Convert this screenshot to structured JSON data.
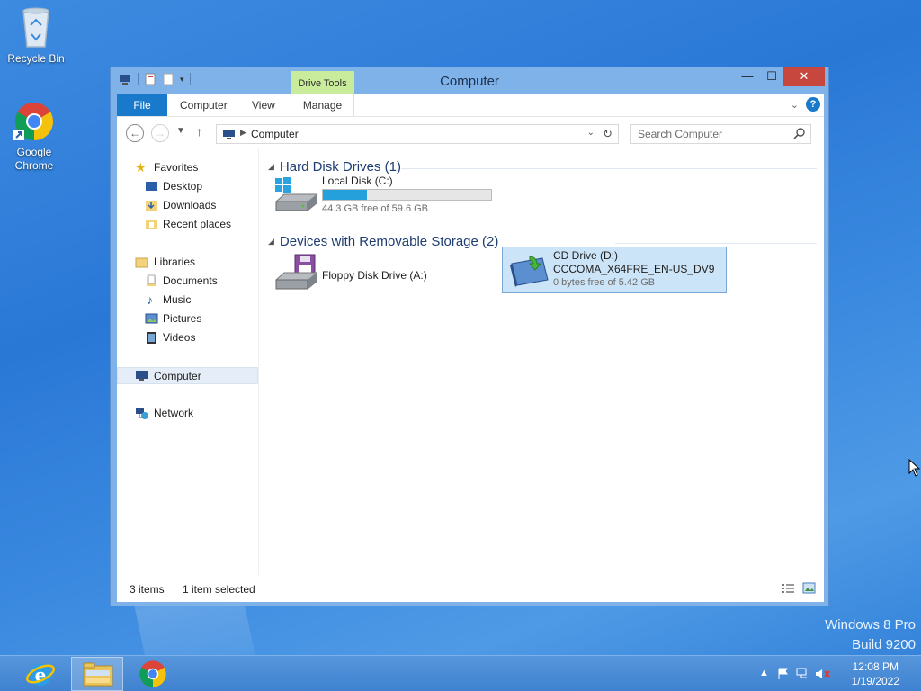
{
  "desktop": {
    "icons": [
      {
        "label": "Recycle Bin"
      },
      {
        "label": "Google Chrome"
      }
    ],
    "watermark": {
      "line1": "Windows 8 Pro",
      "line2": "Build 9200"
    }
  },
  "window": {
    "title": "Computer",
    "context_tab_group": "Drive Tools",
    "ribbon_tabs": [
      "File",
      "Computer",
      "View",
      "Manage"
    ],
    "address": "Computer",
    "search_placeholder": "Search Computer"
  },
  "nav_pane": {
    "favorites": {
      "label": "Favorites",
      "items": [
        "Desktop",
        "Downloads",
        "Recent places"
      ]
    },
    "libraries": {
      "label": "Libraries",
      "items": [
        "Documents",
        "Music",
        "Pictures",
        "Videos"
      ]
    },
    "computer": "Computer",
    "network": "Network"
  },
  "groups": {
    "hard_disks": {
      "title": "Hard Disk Drives (1)",
      "drives": [
        {
          "name": "Local Disk (C:)",
          "free": "44.3 GB free of 59.6 GB",
          "used_fraction": 0.26
        }
      ]
    },
    "removable": {
      "title": "Devices with Removable Storage (2)",
      "drives": [
        {
          "name": "Floppy Disk Drive (A:)"
        },
        {
          "name": "CD Drive (D:)",
          "label": "CCCOMA_X64FRE_EN-US_DV9",
          "free": "0 bytes free of 5.42 GB"
        }
      ]
    }
  },
  "status": {
    "items": "3 items",
    "selected": "1 item selected"
  },
  "taskbar": {
    "apps": [
      "internet-explorer",
      "file-explorer",
      "google-chrome"
    ],
    "time": "12:08 PM",
    "date": "1/19/2022"
  },
  "colors": {
    "accent": "#1979ca",
    "capacity": "#26a0da",
    "context_tab": "#c9ec9c"
  }
}
